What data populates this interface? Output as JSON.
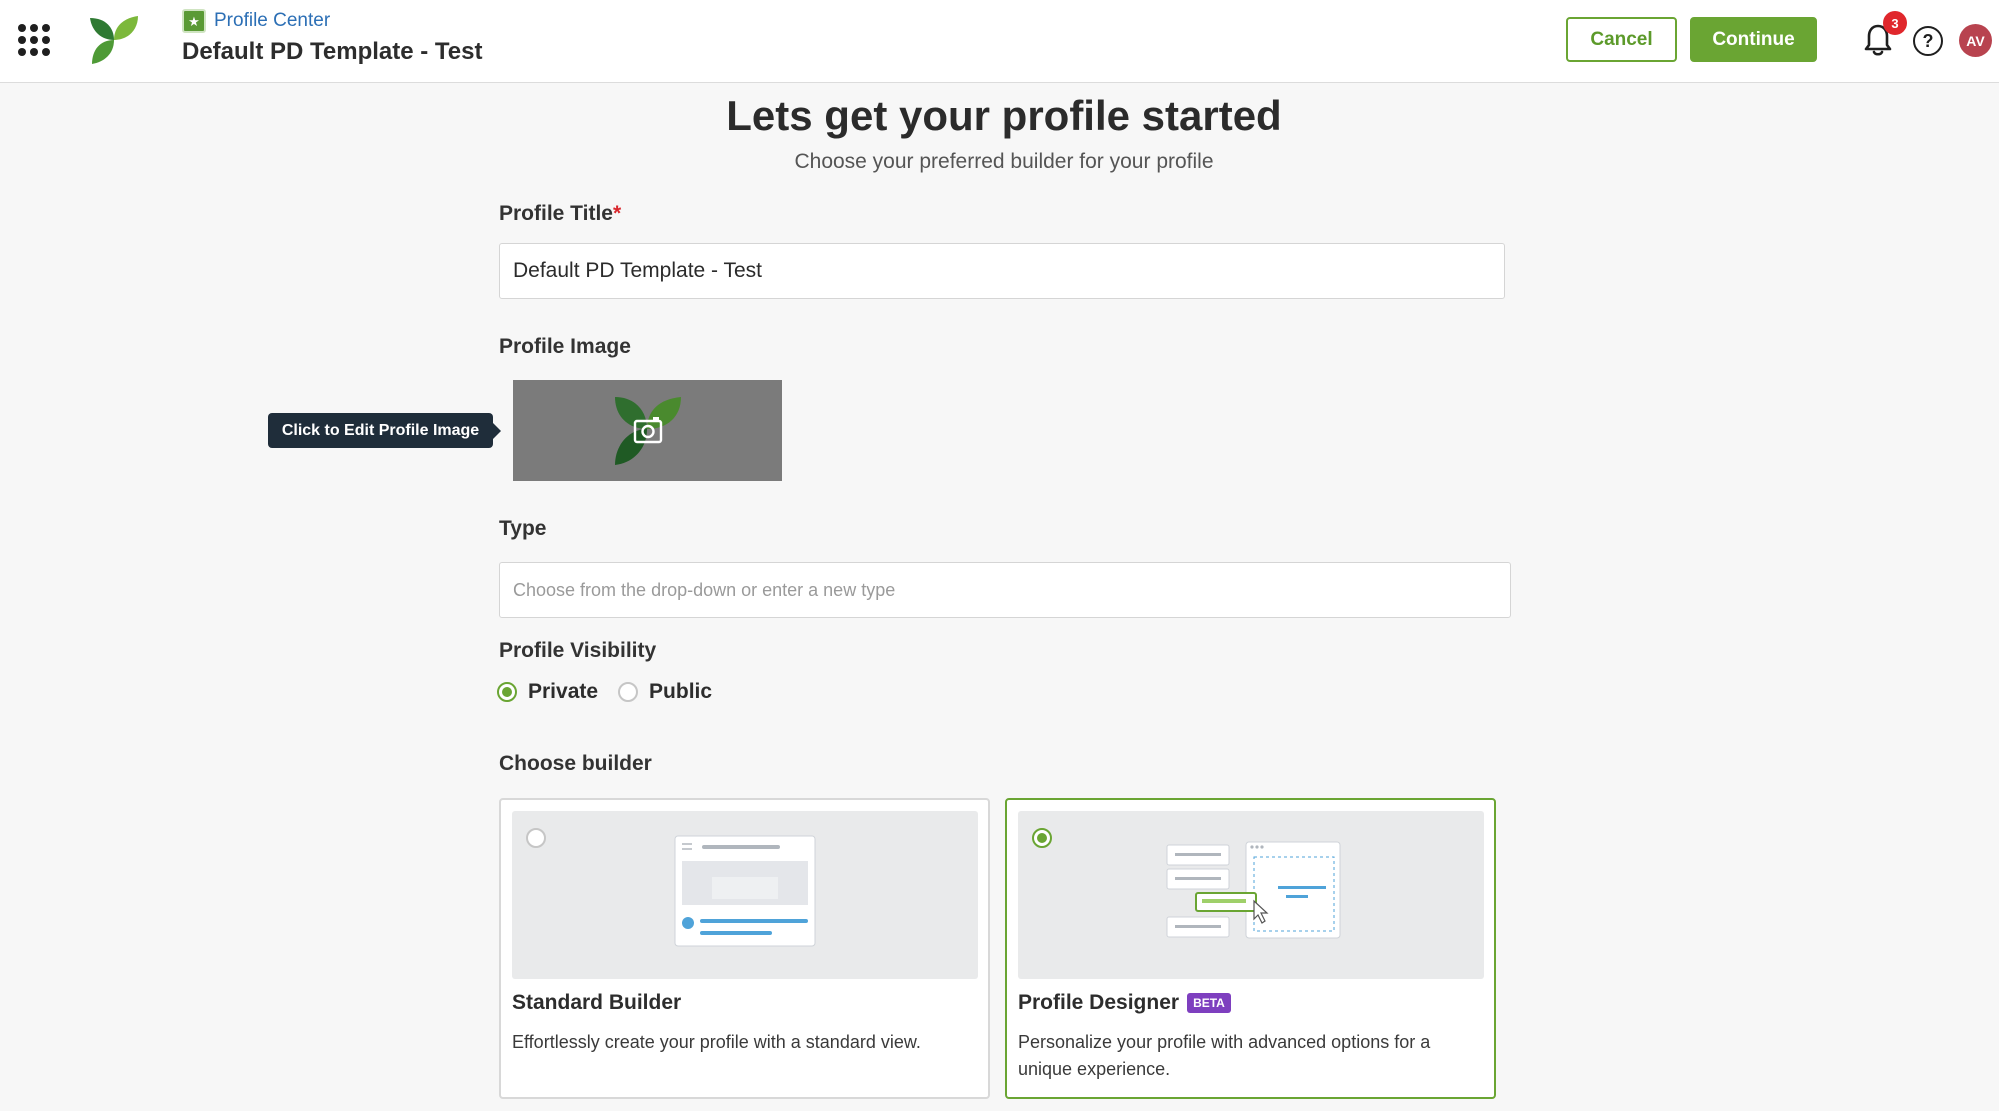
{
  "header": {
    "breadcrumb_label": "Profile Center",
    "page_title": "Default PD Template - Test",
    "cancel_label": "Cancel",
    "continue_label": "Continue",
    "notification_count": "3",
    "help_label": "?",
    "avatar_initials": "AV",
    "accent_color": "#6aa533"
  },
  "main": {
    "heading": "Lets get your profile started",
    "subheading": "Choose your preferred builder for your profile",
    "profile_title_label": "Profile Title",
    "required_mark": "*",
    "profile_title_value": "Default PD Template - Test",
    "profile_image_label": "Profile Image",
    "profile_image_tooltip": "Click to Edit Profile Image",
    "type_label": "Type",
    "type_placeholder": "Choose from the drop-down or enter a new type",
    "visibility_label": "Profile Visibility",
    "visibility_options": [
      {
        "label": "Private",
        "selected": true
      },
      {
        "label": "Public",
        "selected": false
      }
    ],
    "builder_label": "Choose builder",
    "builders": [
      {
        "title": "Standard Builder",
        "badge": "",
        "description": "Effortlessly create your profile with a standard view.",
        "selected": false
      },
      {
        "title": "Profile Designer",
        "badge": "BETA",
        "description": "Personalize your profile with advanced options for a unique experience.",
        "selected": true
      }
    ]
  }
}
